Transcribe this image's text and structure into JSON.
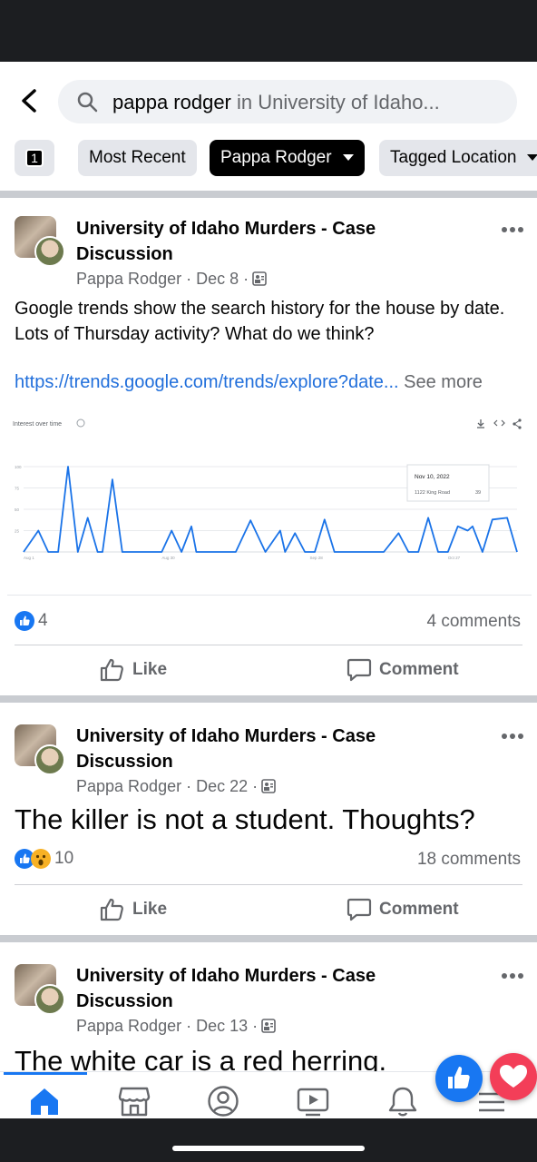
{
  "search": {
    "query": "pappa rodger",
    "scope": " in University of Idaho..."
  },
  "filters": {
    "count": "1",
    "chips": [
      "Most Recent",
      "Pappa Rodger",
      "Tagged Location"
    ]
  },
  "posts": [
    {
      "group": "University of Idaho Murders - Case Discussion",
      "author": "Pappa Rodger",
      "date": "Dec 8",
      "text": "Google trends show the search history for the house by date.  Lots of Thursday activity?  What do we think?",
      "link": "https://trends.google.com/trends/explore?date...",
      "see_more": " See more",
      "reaction_count": "4",
      "comments": "4 comments",
      "like_label": "Like",
      "comment_label": "Comment"
    },
    {
      "group": "University of Idaho Murders - Case Discussion",
      "author": "Pappa Rodger",
      "date": "Dec 22",
      "text": "The killer is not a student.  Thoughts?",
      "reaction_count": "10",
      "comments": "18 comments",
      "like_label": "Like",
      "comment_label": "Comment"
    },
    {
      "group": "University of Idaho Murders - Case Discussion",
      "author": "Pappa Rodger",
      "date": "Dec 13",
      "text": "The white car is a red herring."
    }
  ],
  "chart_data": {
    "type": "line",
    "title": "Interest over time",
    "x_tick_labels": [
      "Aug 1",
      "Aug 30",
      "Sep 28",
      "Oct 27"
    ],
    "y_tick_labels": [
      "100",
      "75",
      "50",
      "25"
    ],
    "ylim": [
      0,
      100
    ],
    "grid": true,
    "series": [
      {
        "name": "1122 King Road",
        "color": "#1a73e8",
        "x": [
          0,
          3,
          5,
          7,
          9,
          11,
          13,
          15,
          16,
          18,
          20,
          22,
          23,
          25,
          26,
          28,
          30,
          32,
          34,
          35,
          37,
          39,
          41,
          43,
          46,
          49,
          52,
          53,
          55,
          57,
          59,
          61,
          63,
          65,
          67,
          70,
          73,
          76,
          78,
          79,
          80,
          82,
          84,
          86,
          88,
          90,
          91,
          93,
          95,
          98,
          100
        ],
        "y": [
          0,
          25,
          0,
          0,
          100,
          0,
          40,
          0,
          0,
          85,
          0,
          0,
          0,
          0,
          0,
          0,
          25,
          0,
          30,
          0,
          0,
          0,
          0,
          0,
          37,
          0,
          25,
          0,
          22,
          0,
          0,
          38,
          0,
          0,
          0,
          0,
          0,
          22,
          0,
          0,
          0,
          40,
          0,
          0,
          30,
          25,
          30,
          0,
          38,
          40,
          0
        ]
      }
    ],
    "tooltip": {
      "date": "Nov 10, 2022",
      "term": "1122 King Road",
      "value": "39"
    }
  },
  "nav": {
    "tabs": [
      "home-icon",
      "marketplace-icon",
      "profile-icon",
      "watch-icon",
      "notifications-icon",
      "menu-icon"
    ]
  }
}
